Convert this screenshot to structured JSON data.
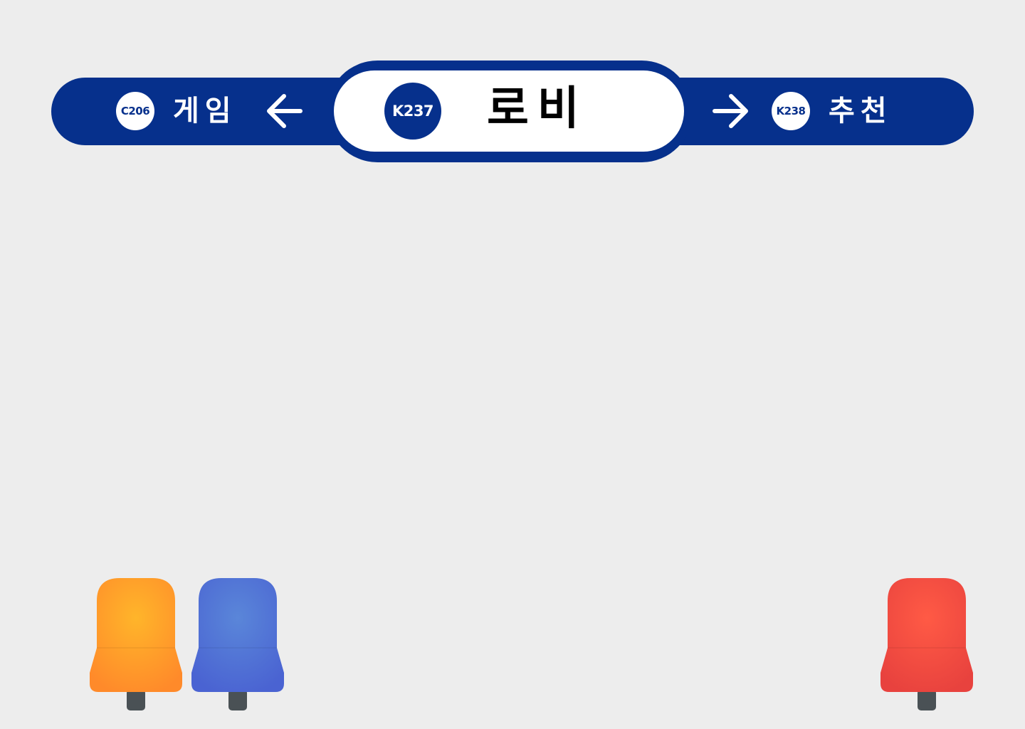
{
  "sign": {
    "current": {
      "code": "K237",
      "name": "로비"
    },
    "previous": {
      "code": "C206",
      "name": "게임",
      "arrow_icon": "arrow-left-icon"
    },
    "next": {
      "code": "K238",
      "name": "추천",
      "arrow_icon": "arrow-right-icon"
    },
    "colors": {
      "line": "#06308c",
      "plate": "#ffffff"
    }
  },
  "seats": [
    {
      "name": "seat-orange",
      "colors": {
        "light": "#ffb52a",
        "dark": "#ff8a2a"
      }
    },
    {
      "name": "seat-blue",
      "colors": {
        "light": "#5a86d9",
        "dark": "#4a63d2"
      }
    },
    {
      "name": "seat-red",
      "colors": {
        "light": "#ff5a45",
        "dark": "#e8423e"
      }
    }
  ]
}
